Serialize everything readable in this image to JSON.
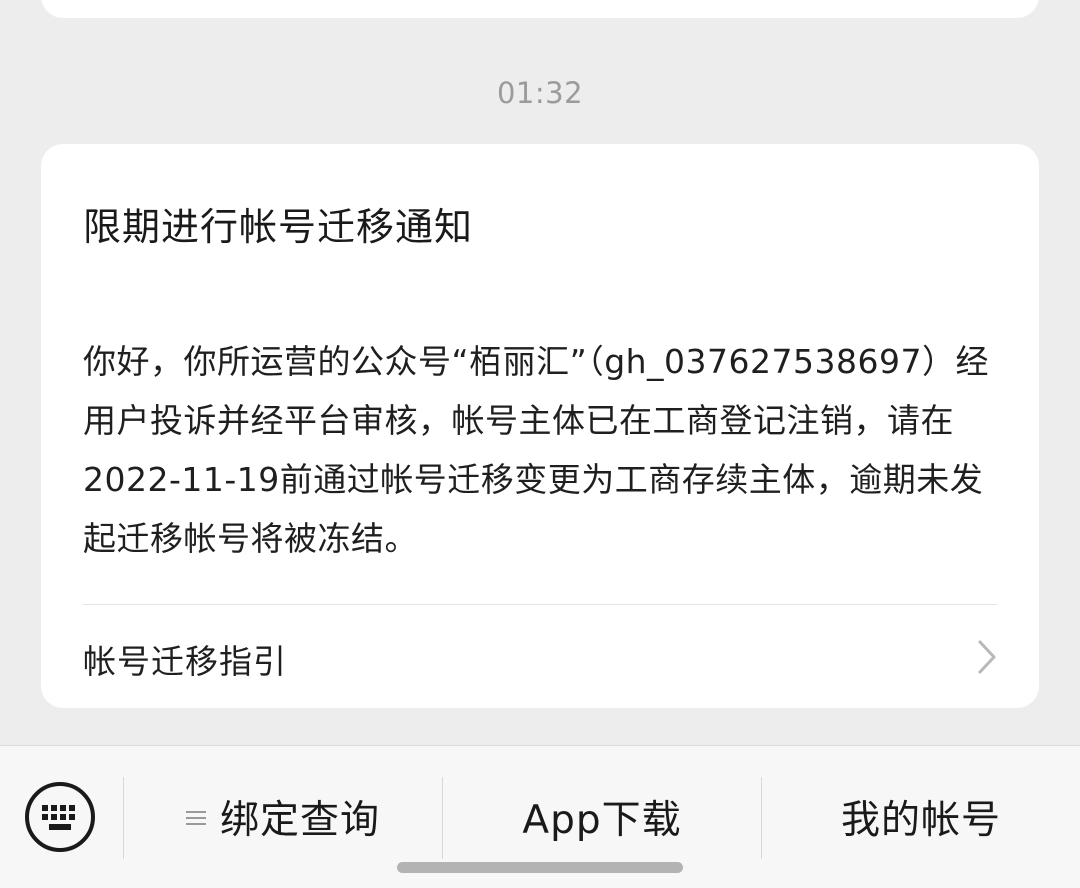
{
  "timestamp": "01:32",
  "message": {
    "title": "限期进行帐号迁移通知",
    "body": "你好，你所运营的公众号“栢丽汇”（gh_037627538697）经用户投诉并经平台审核，帐号主体已在工商登记注销，请在2022-11-19前通过帐号迁移变更为工商存续主体，逾期未发起迁移帐号将被冻结。",
    "link_label": "帐号迁移指引"
  },
  "menu": {
    "items": [
      {
        "label": "绑定查询",
        "icon": "menu-lines-icon"
      },
      {
        "label": "App下载"
      },
      {
        "label": "我的帐号"
      }
    ]
  },
  "icons": {
    "keyboard": "keyboard-icon",
    "chevron": "chevron-right-icon"
  },
  "colors": {
    "background": "#ededed",
    "card": "#ffffff",
    "text": "#1a1a1a",
    "muted": "#9b9b9b"
  }
}
